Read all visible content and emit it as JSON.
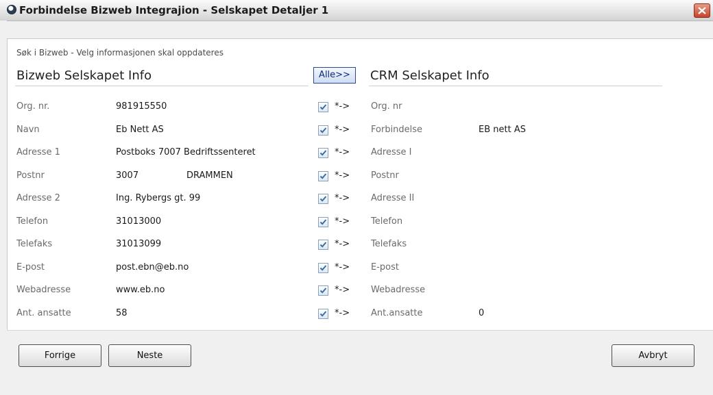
{
  "window": {
    "title": "Forbindelse Bizweb Integrajion - Selskapet Detaljer 1"
  },
  "hint": "Søk i Bizweb - Velg informasjonen skal oppdateres",
  "left_header": "Bizweb Selskapet Info",
  "right_header": "CRM Selskapet Info",
  "alle_button": "Alle>>",
  "arrow_text": "*->",
  "rows": [
    {
      "label": "Org. nr.",
      "value": "981915550",
      "value2": "",
      "crm_label": "Org. nr",
      "crm_value": "",
      "checked": true
    },
    {
      "label": "Navn",
      "value": "Eb Nett AS",
      "value2": "",
      "crm_label": "Forbindelse",
      "crm_value": "EB nett AS",
      "checked": true
    },
    {
      "label": "Adresse 1",
      "value": "Postboks 7007 Bedriftssenteret",
      "value2": "",
      "crm_label": "Adresse I",
      "crm_value": "",
      "checked": true
    },
    {
      "label": "Postnr",
      "value": "3007",
      "value2": "DRAMMEN",
      "crm_label": "Postnr",
      "crm_value": "",
      "checked": true
    },
    {
      "label": "Adresse 2",
      "value": "Ing. Rybergs gt. 99",
      "value2": "",
      "crm_label": "Adresse II",
      "crm_value": "",
      "checked": true
    },
    {
      "label": "Telefon",
      "value": "31013000",
      "value2": "",
      "crm_label": "Telefon",
      "crm_value": "",
      "checked": true
    },
    {
      "label": "Telefaks",
      "value": "31013099",
      "value2": "",
      "crm_label": "Telefaks",
      "crm_value": "",
      "checked": true
    },
    {
      "label": "E-post",
      "value": "post.ebn@eb.no",
      "value2": "",
      "crm_label": "E-post",
      "crm_value": "",
      "checked": true
    },
    {
      "label": "Webadresse",
      "value": "www.eb.no",
      "value2": "",
      "crm_label": "Webadresse",
      "crm_value": "",
      "checked": true
    },
    {
      "label": "Ant. ansatte",
      "value": "58",
      "value2": "",
      "crm_label": "Ant.ansatte",
      "crm_value": "0",
      "checked": true
    }
  ],
  "buttons": {
    "prev": "Forrige",
    "next": "Neste",
    "cancel": "Avbryt"
  },
  "icons": {
    "app": "app-globe-icon",
    "close": "close-icon",
    "check": "checkmark-icon"
  }
}
